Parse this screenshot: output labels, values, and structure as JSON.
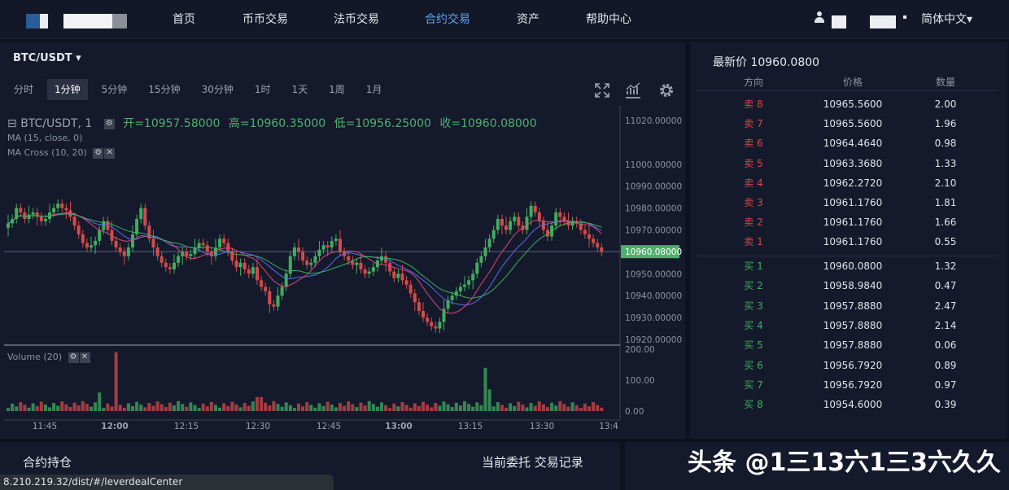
{
  "nav": {
    "items": [
      "首页",
      "币币交易",
      "法币交易",
      "合约交易",
      "资产",
      "帮助中心"
    ],
    "active": "合约交易",
    "language": "简体中文▾"
  },
  "chart": {
    "pair": "BTC/USDT ▾",
    "intervals": [
      "分时",
      "1分钟",
      "5分钟",
      "15分钟",
      "30分钟",
      "1时",
      "1天",
      "1周",
      "1月"
    ],
    "selected_interval": "1分钟",
    "legend_symbol": "BTC/USDT, 1",
    "open": "开=10957.58000",
    "high": "高=10960.35000",
    "low": "低=10956.25000",
    "close": "收=10960.08000",
    "ma_label": "MA (15, close, 0)",
    "ma_cross_label": "MA Cross (10, 20)",
    "volume_label": "Volume (20)",
    "current_price_tag": "10960.08000",
    "price_axis": [
      "11020.00000",
      "11000.00000",
      "10990.00000",
      "10980.00000",
      "10970.00000",
      "10960.08000",
      "10950.00000",
      "10940.00000",
      "10930.00000",
      "10920.00000"
    ],
    "volume_axis": [
      "200.00",
      "100.00",
      "0.00"
    ],
    "time_axis": [
      "11:45",
      "12:00",
      "12:15",
      "12:30",
      "12:45",
      "13:00",
      "13:15",
      "13:30",
      "13:4"
    ],
    "colors": {
      "up": "#3fae5f",
      "down": "#d44a4a"
    }
  },
  "orderbook": {
    "last_price": "最新价 10960.0800",
    "headers": {
      "dir": "方向",
      "price": "价格",
      "qty": "数量"
    },
    "asks": [
      {
        "dir": "卖 8",
        "price": "10965.5600",
        "qty": "2.00"
      },
      {
        "dir": "卖 7",
        "price": "10965.5600",
        "qty": "1.96"
      },
      {
        "dir": "卖 6",
        "price": "10964.4640",
        "qty": "0.98"
      },
      {
        "dir": "卖 5",
        "price": "10963.3680",
        "qty": "1.33"
      },
      {
        "dir": "卖 4",
        "price": "10962.2720",
        "qty": "2.10"
      },
      {
        "dir": "卖 3",
        "price": "10961.1760",
        "qty": "1.81"
      },
      {
        "dir": "卖 2",
        "price": "10961.1760",
        "qty": "1.66"
      },
      {
        "dir": "卖 1",
        "price": "10961.1760",
        "qty": "0.55"
      }
    ],
    "bids": [
      {
        "dir": "买 1",
        "price": "10960.0800",
        "qty": "1.32"
      },
      {
        "dir": "买 2",
        "price": "10958.9840",
        "qty": "0.47"
      },
      {
        "dir": "买 3",
        "price": "10957.8880",
        "qty": "2.47"
      },
      {
        "dir": "买 4",
        "price": "10957.8880",
        "qty": "2.14"
      },
      {
        "dir": "买 5",
        "price": "10957.8880",
        "qty": "0.06"
      },
      {
        "dir": "买 6",
        "price": "10956.7920",
        "qty": "0.89"
      },
      {
        "dir": "买 7",
        "price": "10956.7920",
        "qty": "0.97"
      },
      {
        "dir": "买 8",
        "price": "10954.6000",
        "qty": "0.39"
      }
    ]
  },
  "bottom": {
    "positions_title": "合约持仓",
    "tab_orders": "当前委托",
    "tab_history": "交易记录"
  },
  "watermark": "头条 @1三13六1三3六久久",
  "status_url": "8.210.219.32/dist/#/leverdealCenter"
}
